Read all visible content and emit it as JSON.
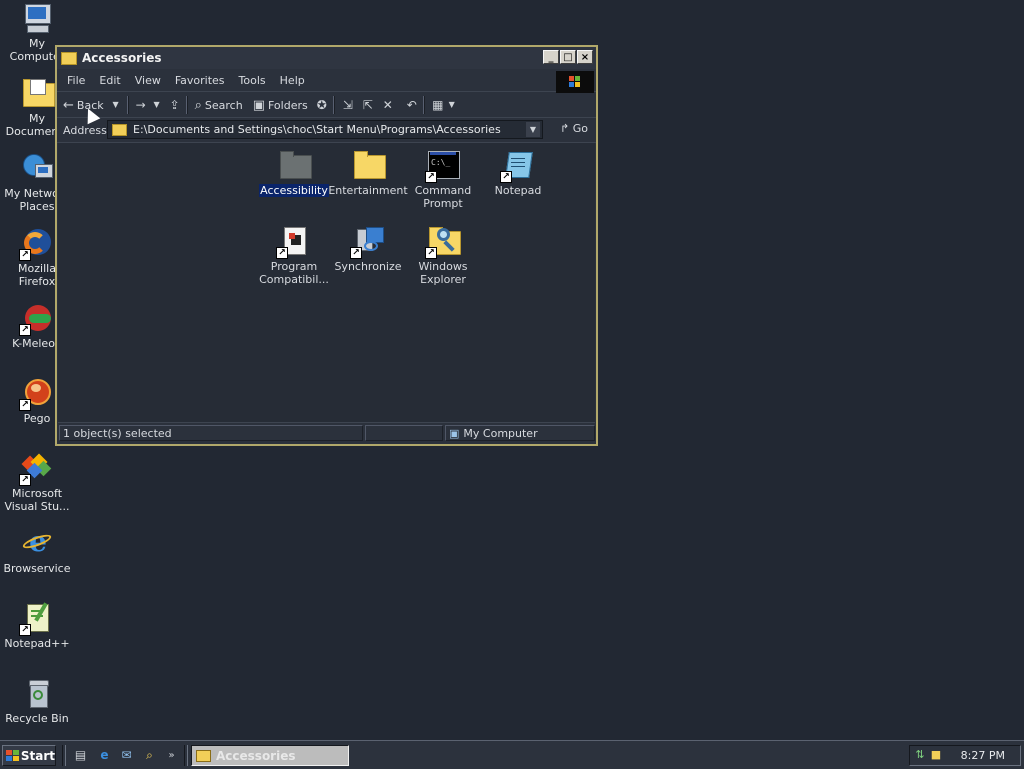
{
  "desktop": {
    "icons": [
      {
        "label": "My Computer",
        "icon": "monitor-icon"
      },
      {
        "label": "My Documents",
        "icon": "documents-folder-icon"
      },
      {
        "label": "My Network\nPlaces",
        "icon": "network-icon"
      },
      {
        "label": "Mozilla Firefox",
        "icon": "firefox-icon"
      },
      {
        "label": "K-Meleon",
        "icon": "kmeleon-icon"
      },
      {
        "label": "Pego",
        "icon": "pego-icon"
      },
      {
        "label": "Microsoft\nVisual Stu...",
        "icon": "visual-studio-icon"
      },
      {
        "label": "Browservice",
        "icon": "internet-explorer-icon"
      },
      {
        "label": "Notepad++",
        "icon": "notepadpp-icon"
      },
      {
        "label": "Recycle Bin",
        "icon": "recycle-bin-icon"
      }
    ]
  },
  "window": {
    "title": "Accessories",
    "menu": [
      "File",
      "Edit",
      "View",
      "Favorites",
      "Tools",
      "Help"
    ],
    "toolbar": {
      "back": "Back",
      "search": "Search",
      "folders": "Folders"
    },
    "address": {
      "label": "Address",
      "path": "E:\\Documents and Settings\\choc\\Start Menu\\Programs\\Accessories",
      "go": "Go"
    },
    "items": [
      {
        "label": "Accessibility",
        "icon": "folder-gray-icon",
        "selected": true
      },
      {
        "label": "Entertainment",
        "icon": "folder-icon",
        "selected": false
      },
      {
        "label": "Command\nPrompt",
        "icon": "command-prompt-icon",
        "selected": false
      },
      {
        "label": "Notepad",
        "icon": "notepad-icon",
        "selected": false
      },
      {
        "label": "Program\nCompatibil...",
        "icon": "program-compat-icon",
        "selected": false
      },
      {
        "label": "Synchronize",
        "icon": "synchronize-icon",
        "selected": false
      },
      {
        "label": "Windows\nExplorer",
        "icon": "windows-explorer-icon",
        "selected": false
      }
    ],
    "status": {
      "selection": "1 object(s) selected",
      "zone": "My Computer"
    }
  },
  "taskbar": {
    "start": "Start",
    "task": "Accessories",
    "clock": "8:27 PM"
  },
  "colors": {
    "desktop": "#222833",
    "window_border": "#b1a86a",
    "selection": "#0a246a",
    "folder": "#f7d766"
  }
}
